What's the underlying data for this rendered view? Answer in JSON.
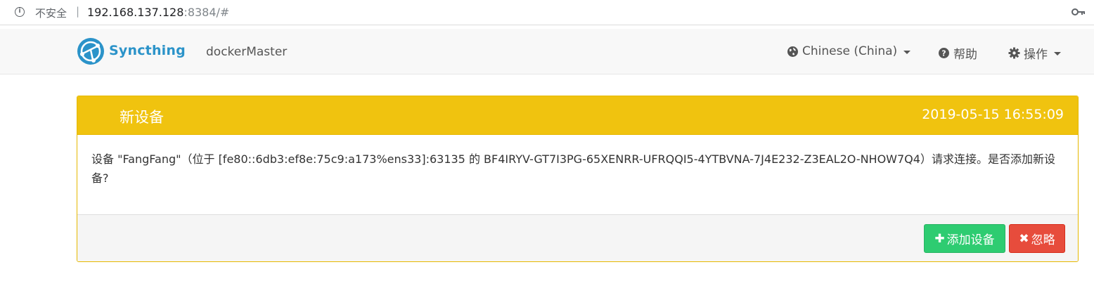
{
  "browser": {
    "security_label": "不安全",
    "separator": "|",
    "url_host": "192.168.137.128",
    "url_port": ":8384/#",
    "info_icon": "info-icon",
    "key_icon": "key-icon"
  },
  "navbar": {
    "brand": "Syncthing",
    "device_name": "dockerMaster",
    "language": "Chinese (China)",
    "help": "帮助",
    "actions": "操作",
    "brand_color": "#2b93c9"
  },
  "notice": {
    "title": "新设备",
    "timestamp": "2019-05-15 16:55:09",
    "message": "设备 \"FangFang\"（位于 [fe80::6db3:ef8e:75c9:a173%ens33]:63135 的 BF4IRYV-GT7I3PG-65XENRR-UFRQQI5-4YTBVNA-7J4E232-Z3EAL2O-NHOW7Q4）请求连接。是否添加新设备?",
    "add_button": "添加设备",
    "ignore_button": "忽略",
    "heading_color": "#f0c30f",
    "add_color": "#2ecc71",
    "ignore_color": "#e74c3c"
  }
}
